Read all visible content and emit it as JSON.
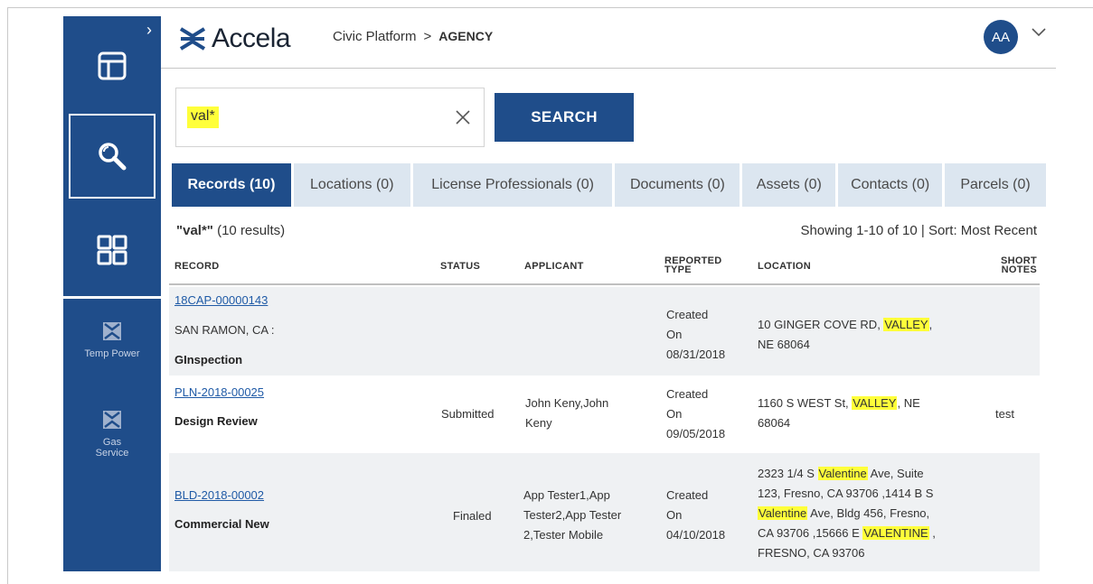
{
  "header": {
    "logo_text": "Accela",
    "breadcrumb_platform": "Civic Platform",
    "breadcrumb_sep": ">",
    "breadcrumb_agency": "AGENCY",
    "avatar_initials": "AA"
  },
  "sidebar": {
    "apps": [
      {
        "label": "Temp Power",
        "icon": "app-bowtie-icon"
      },
      {
        "label": "Gas Service",
        "icon": "app-bowtie-icon"
      }
    ]
  },
  "search": {
    "value": "val*",
    "button_label": "SEARCH"
  },
  "tabs": [
    {
      "label": "Records (10)",
      "active": true
    },
    {
      "label": "Locations (0)",
      "active": false
    },
    {
      "label": "License Professionals (0)",
      "active": false
    },
    {
      "label": "Documents (0)",
      "active": false
    },
    {
      "label": "Assets (0)",
      "active": false
    },
    {
      "label": "Contacts (0)",
      "active": false
    },
    {
      "label": "Parcels (0)",
      "active": false
    }
  ],
  "results": {
    "query_label": "\"val*\"",
    "count_text": "(10 results)",
    "showing": "Showing 1-10 of 10 | Sort: Most Recent"
  },
  "table": {
    "headers": {
      "record": "RECORD",
      "status": "STATUS",
      "applicant": "APPLICANT",
      "reported_type_1": "REPORTED",
      "reported_type_2": "TYPE",
      "location": "LOCATION",
      "short_notes_1": "SHORT",
      "short_notes_2": "NOTES"
    },
    "rows": [
      {
        "record_id": "18CAP-00000143",
        "record_sub": "SAN RAMON, CA :",
        "record_type": "GInspection",
        "status": "",
        "applicant": "",
        "reported_1": "Created",
        "reported_2": "On",
        "reported_3": "08/31/2018",
        "loc_1a": "10 GINGER COVE RD, ",
        "loc_1h": "VALLEY",
        "loc_1b": ",",
        "loc_2": "NE 68064",
        "notes": ""
      },
      {
        "record_id": "PLN-2018-00025",
        "record_type": "Design Review",
        "status": "Submitted",
        "applicant_1": "John Keny,John",
        "applicant_2": "Keny",
        "reported_1": "Created",
        "reported_2": "On",
        "reported_3": "09/05/2018",
        "loc_1a": "1160 S WEST St, ",
        "loc_1h": "VALLEY",
        "loc_1b": ", NE",
        "loc_2": "68064",
        "notes": "test"
      },
      {
        "record_id": "BLD-2018-00002",
        "record_type": "Commercial New",
        "status": "Finaled",
        "applicant_1": "App Tester1,App",
        "applicant_2": "Tester2,App Tester",
        "applicant_3": "2,Tester Mobile",
        "reported_1": "Created",
        "reported_2": "On",
        "reported_3": "04/10/2018",
        "loc_1a": "2323 1/4 S ",
        "loc_1h": "Valentine",
        "loc_1b": " Ave, Suite",
        "loc_2": "123, Fresno, CA 93706 ,1414 B S",
        "loc_3h": "Valentine",
        "loc_3b": " Ave, Bldg 456, Fresno,",
        "loc_4a": "CA 93706 ,15666 E ",
        "loc_4h": "VALENTINE",
        "loc_4b": " ,",
        "loc_5": "FRESNO, CA 93706",
        "notes": ""
      }
    ]
  },
  "colors": {
    "brand": "#1f4d8a",
    "tab_inactive": "#dce6f0",
    "highlight": "#ffff3a",
    "link": "#1f5aa6"
  }
}
